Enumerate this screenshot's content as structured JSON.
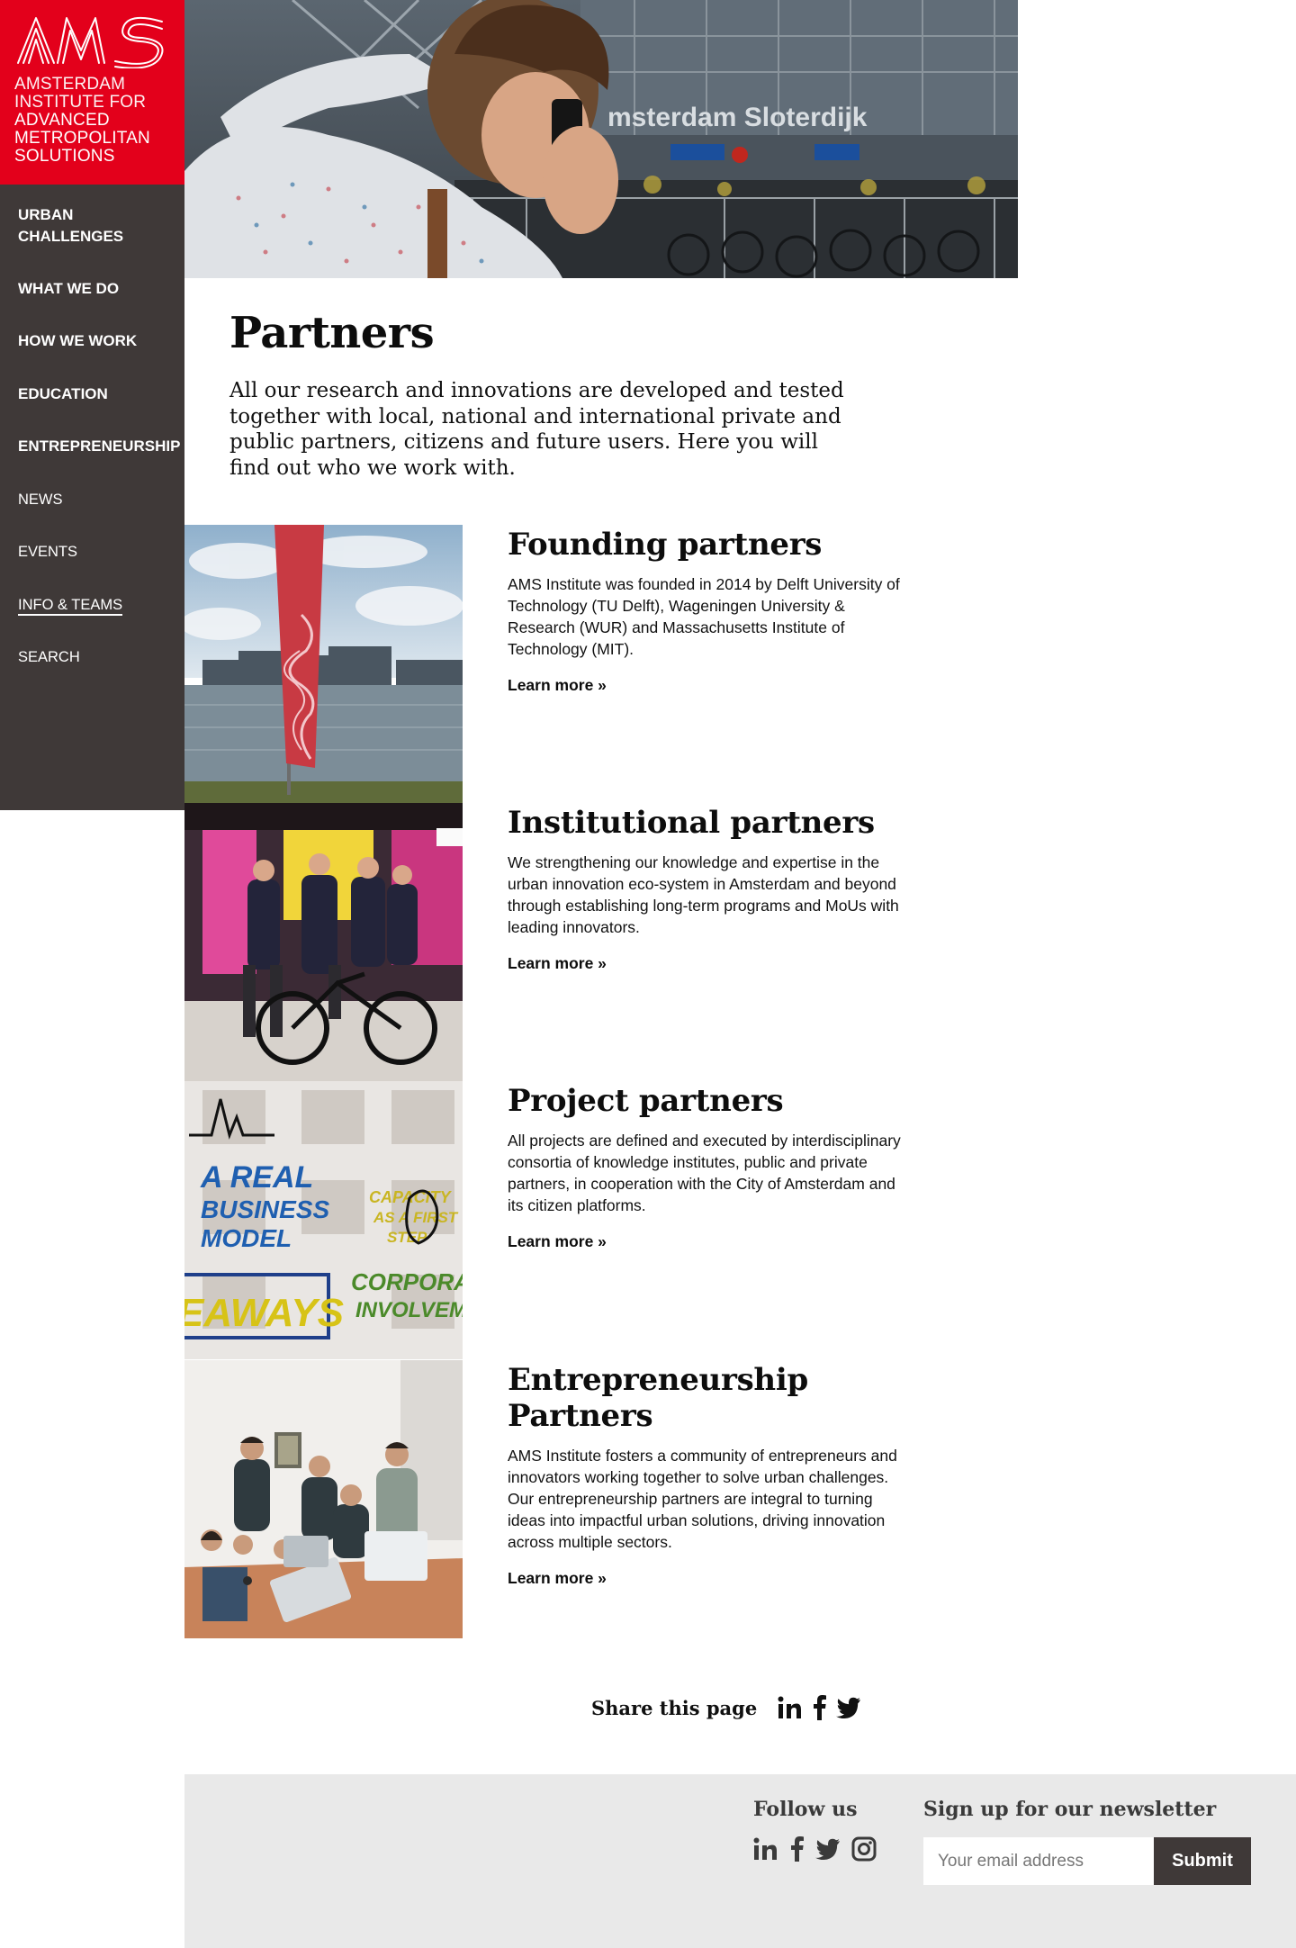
{
  "brand": {
    "logo_mark": "AMS",
    "line1": "AMSTERDAM",
    "line2": "INSTITUTE FOR",
    "line3": "ADVANCED",
    "line4": "METROPOLITAN",
    "line5": "SOLUTIONS",
    "color": "#e3001b"
  },
  "nav": {
    "items": [
      {
        "label": "URBAN CHALLENGES"
      },
      {
        "label": "WHAT WE DO"
      },
      {
        "label": "HOW WE WORK"
      },
      {
        "label": "EDUCATION"
      },
      {
        "label": "ENTREPRENEURSHIP"
      },
      {
        "label": "NEWS"
      },
      {
        "label": "EVENTS"
      },
      {
        "label": "INFO & TEAMS"
      },
      {
        "label": "SEARCH"
      }
    ],
    "active": "INFO & TEAMS"
  },
  "hero": {
    "sign_text": "msterdam Sloterdijk"
  },
  "page": {
    "title": "Partners",
    "intro": "All our research and innovations are developed and tested together with local, national and international private and public partners, citizens and future users. Here you will find out who we work with."
  },
  "partners": [
    {
      "title": "Founding partners",
      "text": "AMS Institute was founded in 2014 by Delft University of Technology (TU Delft), Wageningen University & Research (WUR) and Massachusetts Institute of Technology (MIT).",
      "link": "Learn more »"
    },
    {
      "title": "Institutional partners",
      "text": "We strengthening our knowledge and expertise in the urban innovation eco-system in Amsterdam and beyond through establishing long-term programs and MoUs with leading innovators.",
      "link": "Learn more »"
    },
    {
      "title": "Project partners",
      "text": "All projects are defined and executed by interdisciplinary consortia of knowledge institutes, public and private partners, in cooperation with the City of Amsterdam and its citizen platforms.",
      "link": "Learn more »",
      "image_words": [
        "A REAL",
        "BUSINESS",
        "MODEL",
        "CAPACITY",
        "AS A FIRST",
        "STEP",
        "CORPORATE",
        "INVOLVEMEN",
        "EAWAYS"
      ]
    },
    {
      "title": "Entrepreneurship Partners",
      "text": "AMS Institute fosters a community of entrepreneurs and innovators working together to solve urban challenges. Our entrepreneurship partners are integral to turning ideas into impactful urban solutions, driving innovation across multiple sectors.",
      "link": "Learn more »"
    }
  ],
  "share": {
    "label": "Share this page",
    "icons": [
      "linkedin-icon",
      "facebook-icon",
      "twitter-icon"
    ]
  },
  "footer": {
    "follow_label": "Follow us",
    "follow_icons": [
      "linkedin-icon",
      "facebook-icon",
      "twitter-icon",
      "instagram-icon"
    ],
    "newsletter_label": "Sign up for our newsletter",
    "email_placeholder": "Your email address",
    "submit_label": "Submit"
  }
}
